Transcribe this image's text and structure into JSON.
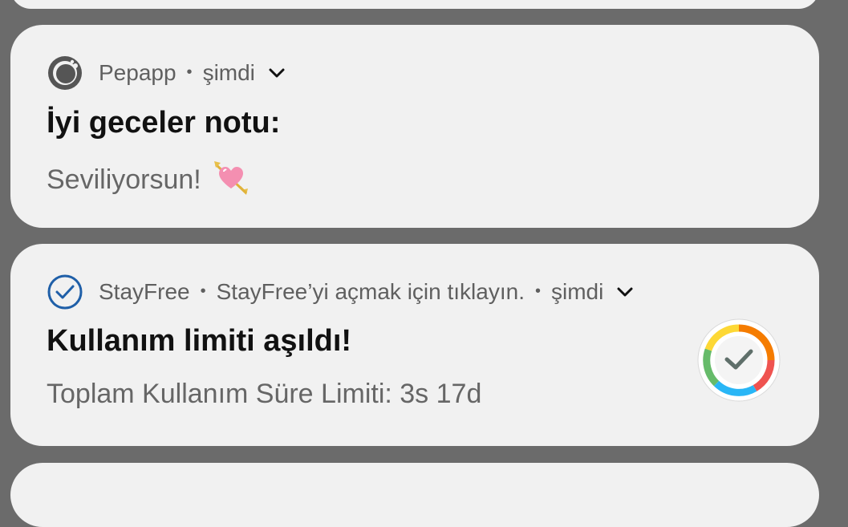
{
  "notifications": [
    {
      "app_name": "Pepapp",
      "separator": "•",
      "time": "şimdi",
      "title": "İyi geceler notu:",
      "text": "Seviliyorsun!",
      "app_icon": "pepapp-ring-icon",
      "emoji": "heart-with-arrow-emoji",
      "expand_icon": "chevron-down-icon"
    },
    {
      "app_name": "StayFree",
      "separator": "•",
      "subtext": "StayFree’yi açmak için tıklayın.",
      "separator2": "•",
      "time": "şimdi",
      "title": "Kullanım limiti aşıldı!",
      "text": "Toplam Kullanım Süre Limiti: 3s 17d",
      "app_icon": "check-circle-icon",
      "large_icon": "stayfree-app-icon",
      "expand_icon": "chevron-down-icon"
    }
  ],
  "colors": {
    "background": "#6b6b6b",
    "card": "#f1f1f1",
    "title": "#111111",
    "secondary_text": "#5f5f5f",
    "stayfree_blue": "#1f5fa8",
    "pepapp_gray": "#555555"
  }
}
